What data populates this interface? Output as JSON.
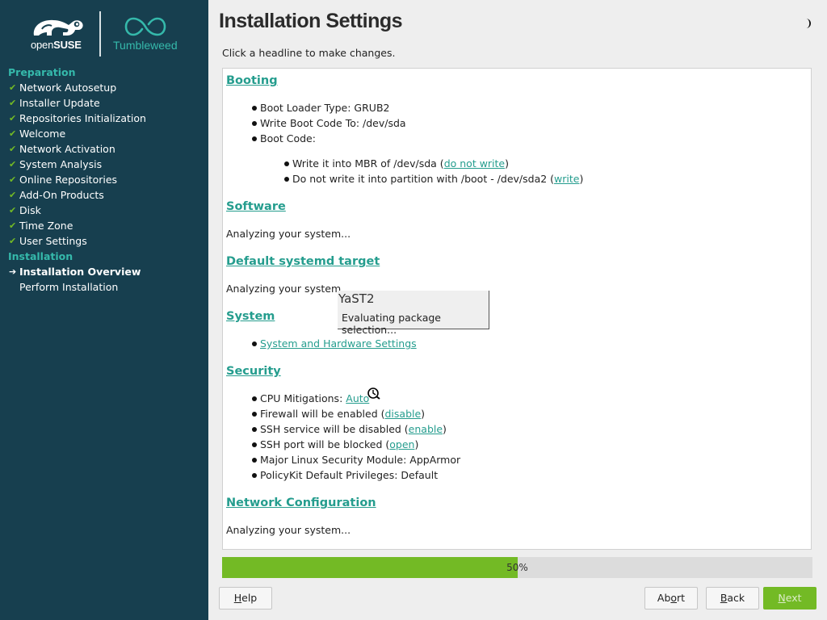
{
  "sidebar": {
    "logo": {
      "open": "open",
      "suse": "SUSE",
      "product": "Tumbleweed"
    },
    "groups": [
      {
        "heading": "Preparation",
        "steps": [
          {
            "label": "Network Autosetup",
            "status": "done"
          },
          {
            "label": "Installer Update",
            "status": "done"
          },
          {
            "label": "Repositories Initialization",
            "status": "done"
          },
          {
            "label": "Welcome",
            "status": "done"
          },
          {
            "label": "Network Activation",
            "status": "done"
          },
          {
            "label": "System Analysis",
            "status": "done"
          },
          {
            "label": "Online Repositories",
            "status": "done"
          },
          {
            "label": "Add-On Products",
            "status": "done"
          },
          {
            "label": "Disk",
            "status": "done"
          },
          {
            "label": "Time Zone",
            "status": "done"
          },
          {
            "label": "User Settings",
            "status": "done"
          }
        ]
      },
      {
        "heading": "Installation",
        "steps": [
          {
            "label": "Installation Overview",
            "status": "current"
          },
          {
            "label": "Perform Installation",
            "status": "pending"
          }
        ]
      }
    ]
  },
  "header": {
    "title": "Installation Settings",
    "subtitle": "Click a headline to make changes."
  },
  "sections": {
    "booting": {
      "heading": "Booting",
      "boot_loader": "Boot Loader Type: GRUB2",
      "write_code": "Write Boot Code To: /dev/sda",
      "boot_code": "Boot Code:",
      "mbr_text": "Write it into MBR of /dev/sda (",
      "mbr_link": "do not write",
      "mbr_close": ")",
      "partition_text": "Do not write it into partition with /boot - /dev/sda2 (",
      "partition_link": "write",
      "partition_close": ")"
    },
    "software": {
      "heading": "Software",
      "text": "Analyzing your system..."
    },
    "systemd": {
      "heading": "Default systemd target",
      "text": "Analyzing your system..."
    },
    "system": {
      "heading": "System",
      "link": "System and Hardware Settings"
    },
    "security": {
      "heading": "Security",
      "cpu_text": "CPU Mitigations: ",
      "cpu_link": "Auto",
      "firewall_text": "Firewall will be enabled (",
      "firewall_link": "disable",
      "ssh_text": "SSH service will be disabled (",
      "ssh_link": "enable",
      "port_text": "SSH port will be blocked (",
      "port_link": "open",
      "close": ")",
      "lsm": "Major Linux Security Module: AppArmor",
      "polkit": "PolicyKit Default Privileges: Default"
    },
    "network": {
      "heading": "Network Configuration",
      "text": "Analyzing your system..."
    }
  },
  "popup": {
    "title": "YaST2",
    "message": "Evaluating package selection..."
  },
  "progress": {
    "value": 0.5,
    "label": "50%"
  },
  "buttons": {
    "help": {
      "mnemonic": "H",
      "rest": "elp"
    },
    "abort": {
      "before": "Ab",
      "mnemonic": "o",
      "after": "rt"
    },
    "back": {
      "mnemonic": "B",
      "rest": "ack"
    },
    "next": {
      "mnemonic": "N",
      "rest": "ext"
    }
  },
  "colors": {
    "sidebar_bg": "#173f4f",
    "accent_teal": "#35b9ab",
    "link": "#259d8e",
    "green": "#73ba25"
  }
}
